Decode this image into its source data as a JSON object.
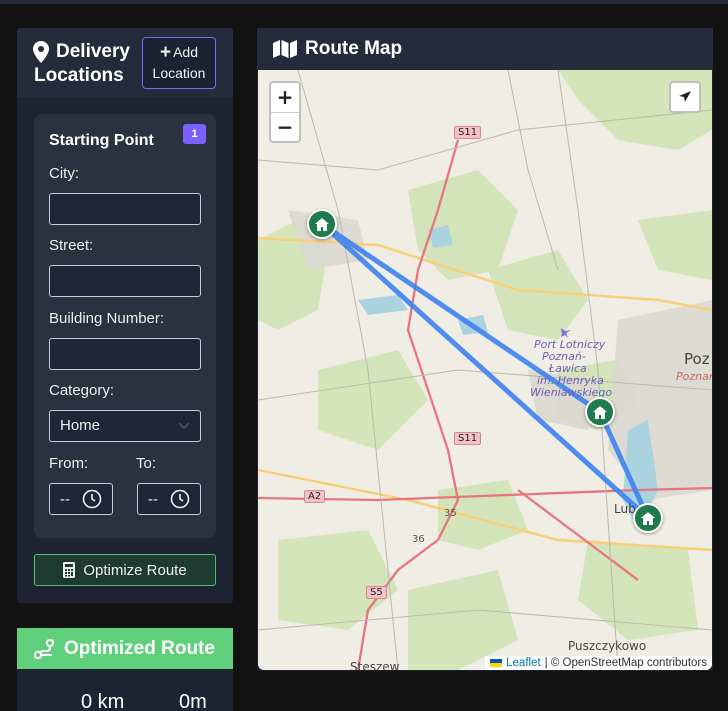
{
  "delivery": {
    "title": "Delivery Locations",
    "add_button": {
      "icon": "+",
      "label": "Add Location"
    }
  },
  "start_card": {
    "title": "Starting Point",
    "badge": "1",
    "city_label": "City:",
    "city_value": "",
    "street_label": "Street:",
    "street_value": "",
    "building_label": "Building Number:",
    "building_value": "",
    "category_label": "Category:",
    "category_value": "Home",
    "from_label": "From:",
    "from_value": "--",
    "to_label": "To:",
    "to_value": "--"
  },
  "optimize_button": {
    "label": "Optimize Route",
    "icon": "calculator-icon"
  },
  "optimized": {
    "title": "Optimized Route",
    "distance": "0 km",
    "duration": "0m"
  },
  "map_panel": {
    "title": "Route Map",
    "zoom_in": "+",
    "zoom_out": "−",
    "attribution_leaflet": "Leaflet",
    "attribution_rest": "| © OpenStreetMap contributors",
    "labels": {
      "airport_1": "Port Lotniczy",
      "airport_2": "Poznań-",
      "airport_3": "Ławica",
      "airport_4": "im. Henryka",
      "airport_5": "Wieniawskiego",
      "poz": "Poz",
      "poznan": "Poznań",
      "luboń": "Lub",
      "puszczykowo": "Puszczykowo",
      "steszew": "Steszew",
      "s11_a": "S11",
      "s11_b": "S11",
      "a2": "A2",
      "s5": "S5",
      "r35": "35",
      "r36": "36"
    }
  },
  "colors": {
    "accent": "#7b61ff",
    "success": "#5fcf7b",
    "route": "#3d82f0",
    "marker": "#1f7a4d"
  }
}
